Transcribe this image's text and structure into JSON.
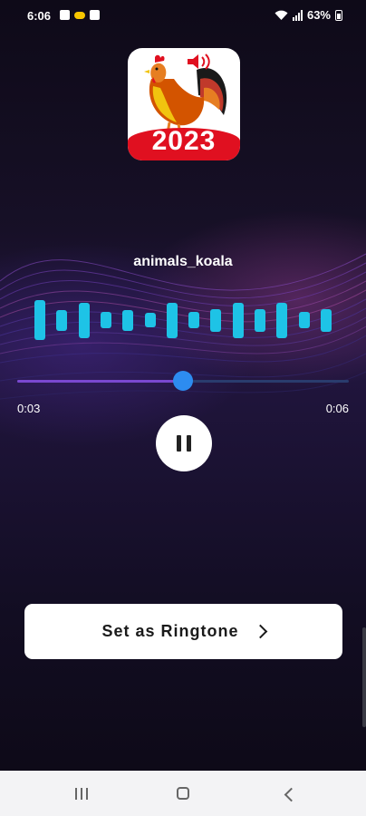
{
  "status_bar": {
    "time": "6:06",
    "battery": "63%"
  },
  "app": {
    "icon_year": "2023"
  },
  "player": {
    "sound_name": "animals_koala",
    "current_time": "0:03",
    "total_time": "0:06",
    "progress": 0.5,
    "waveform_levels": [
      0.95,
      0.5,
      0.85,
      0.4,
      0.5,
      0.35,
      0.85,
      0.4,
      0.55,
      0.85,
      0.55,
      0.85,
      0.4,
      0.55
    ],
    "waveform_color": "#1ec3e6",
    "state": "playing"
  },
  "actions": {
    "set_ringtone_label": "Set as Ringtone"
  },
  "nav": {
    "recents": "recents-icon",
    "home": "home-icon",
    "back": "back-icon"
  }
}
